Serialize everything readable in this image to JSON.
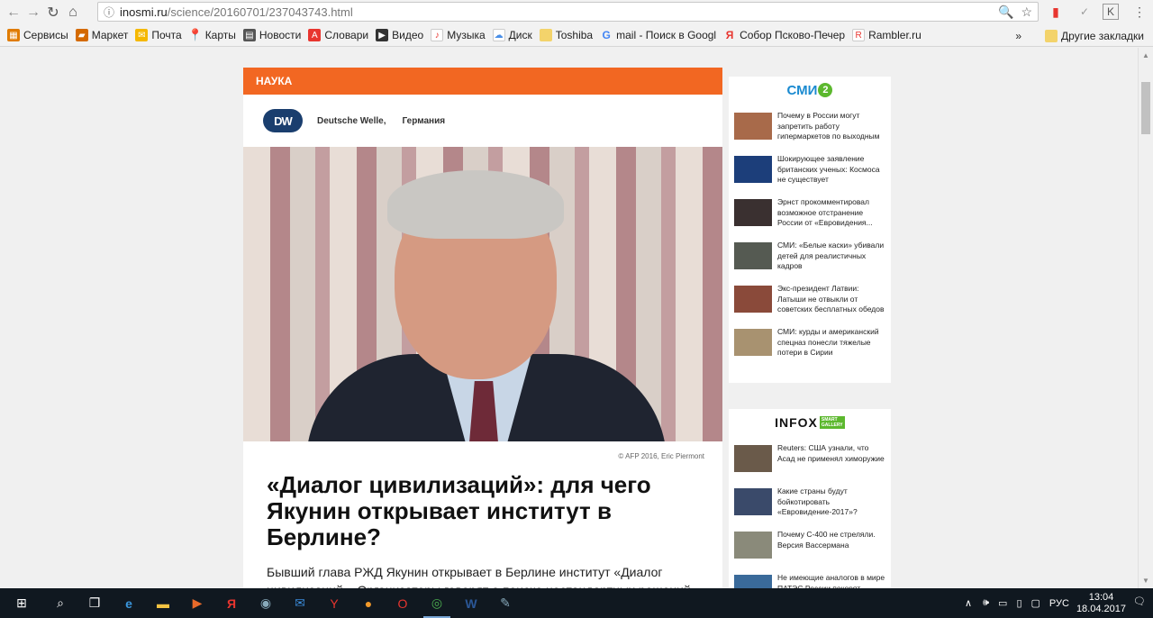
{
  "browser": {
    "url_host": "inosmi.ru",
    "url_path": "/science/20160701/237043743.html",
    "bookmarks": [
      {
        "label": "Сервисы",
        "color": "#e0a000"
      },
      {
        "label": "Маркет",
        "color": "#f5b800"
      },
      {
        "label": "Почта",
        "color": "#ffcc00"
      },
      {
        "label": "Карты",
        "color": "#e8352f"
      },
      {
        "label": "Новости",
        "color": "#555555"
      },
      {
        "label": "Словари",
        "color": "#e8352f"
      },
      {
        "label": "Видео",
        "color": "#333333"
      },
      {
        "label": "Музыка",
        "color": "#e8352f"
      },
      {
        "label": "Диск",
        "color": "#4a8fe7"
      },
      {
        "label": "Toshiba",
        "color": "#f3d36b"
      },
      {
        "label": "mail - Поиск в Googl",
        "color": "#4285f4"
      },
      {
        "label": "Собор Псково-Печер",
        "color": "#e8352f"
      },
      {
        "label": "Rambler.ru",
        "color": "#e8352f"
      }
    ],
    "other_bookmarks": "Другие закладки",
    "overflow": "»"
  },
  "article": {
    "section": "НАУКА",
    "source_logo": "DW",
    "source_name": "Deutsche Welle,",
    "source_country": "Германия",
    "photo_credit": "© AFP 2016, Eric Piermont",
    "headline": "«Диалог цивилизаций»: для чего Якунин открывает институт в Берлине?",
    "lead": "Бывший глава РЖД Якунин открывает в Берлине институт «Диалог цивилизаций». Организаторы говорят о поиске нестандартных решений"
  },
  "widget_smi2": {
    "title": "СМИ",
    "badge": "2",
    "items": [
      {
        "text": "Почему в России могут запретить работу гипермаркетов по выходным",
        "thumb": "#a86a4a"
      },
      {
        "text": "Шокирующее заявление британских ученых: Космоса не существует",
        "thumb": "#1c3e7a"
      },
      {
        "text": "Эрнст прокомментировал возможное отстранение России от «Евровидения...",
        "thumb": "#3a3030"
      },
      {
        "text": "СМИ: «Белые каски» убивали детей для реалистичных кадров",
        "thumb": "#555a52"
      },
      {
        "text": "Экс-президент Латвии: Латыши не отвыкли от советских бесплатных обедов",
        "thumb": "#8a4a3a"
      },
      {
        "text": "СМИ: курды и американский спецназ понесли тяжелые потери в Сирии",
        "thumb": "#a89270"
      }
    ]
  },
  "widget_infox": {
    "title": "INFOX",
    "badge": "SMART GALLERY",
    "items": [
      {
        "text": "Reuters: США узнали, что Асад не применял химоружие",
        "thumb": "#6a5a4a"
      },
      {
        "text": "Какие страны будут бойкотировать «Евровидение-2017»?",
        "thumb": "#3a4a6a"
      },
      {
        "text": "Почему С-400 не стреляли. Версия Вассермана",
        "thumb": "#8a8a7a"
      },
      {
        "text": "Не имеющие аналогов в мире ПАТЭС России покорят арабские страны",
        "thumb": "#3a6a9a"
      }
    ]
  },
  "taskbar": {
    "lang": "РУС",
    "time": "13:04",
    "date": "18.04.2017",
    "notifications": "1"
  }
}
